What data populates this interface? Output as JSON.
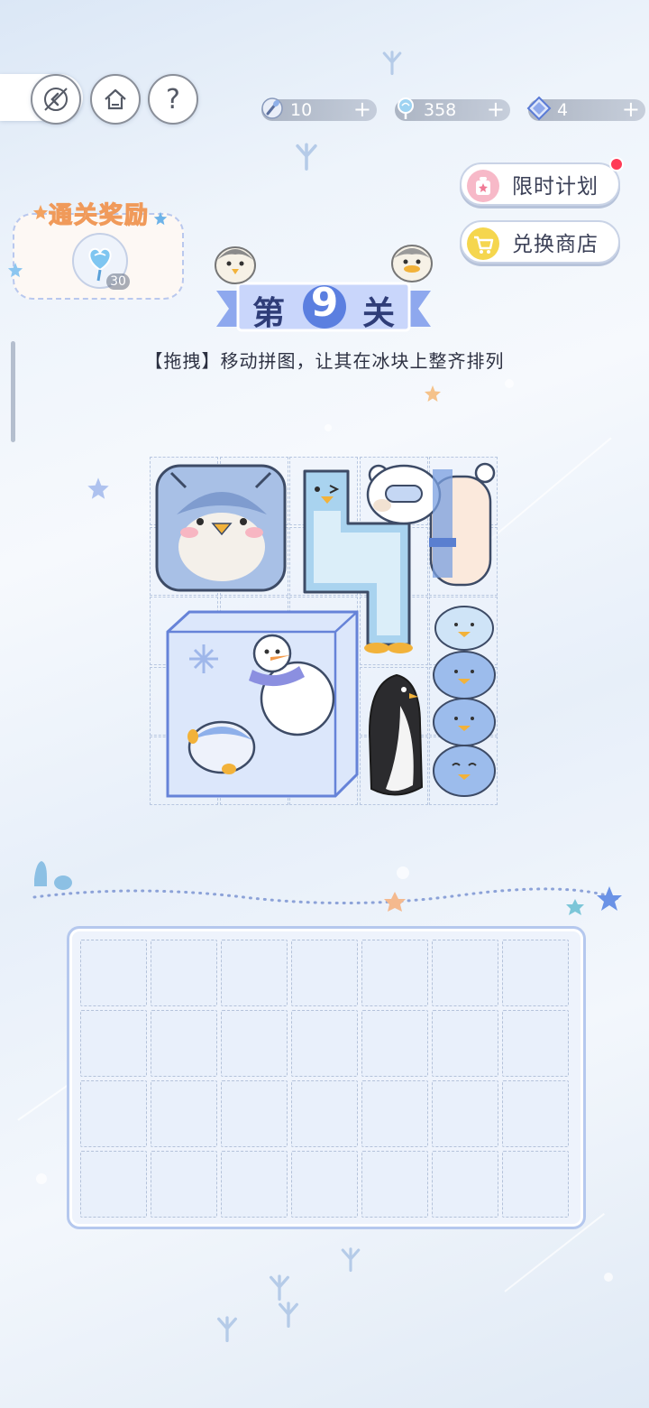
{
  "topbar": {
    "back_icon": "back-arrow-icon",
    "home_icon": "home-icon",
    "help_icon": "question-icon",
    "help_glyph": "?",
    "resources": [
      {
        "icon": "shovel-icon",
        "value": "10",
        "plus": "+"
      },
      {
        "icon": "lollipop-icon",
        "value": "358",
        "plus": "+"
      },
      {
        "icon": "diamond-icon",
        "value": "4",
        "plus": "+"
      }
    ]
  },
  "side_buttons": {
    "plan_label": "限时计划",
    "plan_icon": "gift-icon",
    "shop_label": "兑换商店",
    "shop_icon": "cart-icon",
    "plan_badge_color": "#ff3b57"
  },
  "reward": {
    "title": "通关奖励",
    "item_icon": "heart-lollipop-icon",
    "count": "30"
  },
  "level": {
    "prefix": "第",
    "number": "9",
    "suffix": "关",
    "instruction": "【拖拽】移动拼图，让其在冰块上整齐排列"
  },
  "board": {
    "grid_cols": 5,
    "grid_rows": 5,
    "pieces": [
      {
        "name": "fat-penguin-piece",
        "icon": "fat-penguin-icon"
      },
      {
        "name": "long-penguin-piece",
        "icon": "long-penguin-icon"
      },
      {
        "name": "polar-bear-piece",
        "icon": "polar-bear-icon"
      },
      {
        "name": "snowman-ice-block-piece",
        "icon": "snowman-icon"
      },
      {
        "name": "black-penguin-piece",
        "icon": "black-penguin-icon"
      },
      {
        "name": "stacked-penguins-piece",
        "icon": "penguin-stack-icon"
      }
    ]
  },
  "tray": {
    "cols": 7,
    "rows": 4
  },
  "colors": {
    "accent_blue": "#5b7fe0",
    "banner_blue": "#8ea8ee",
    "reward_orange": "#f09a5a",
    "badge_red": "#ff3b57"
  }
}
